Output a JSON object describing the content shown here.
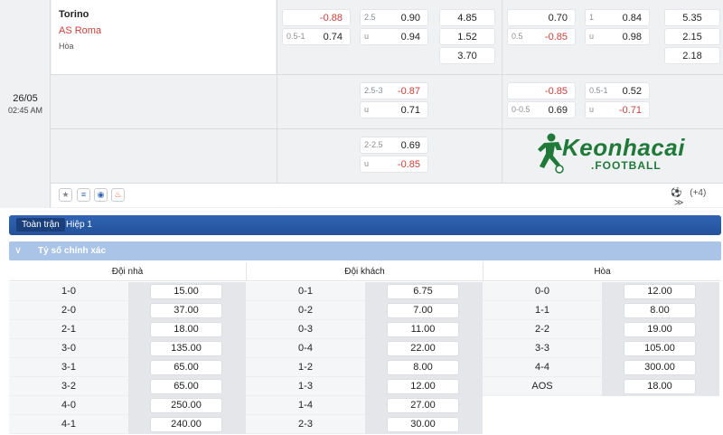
{
  "match": {
    "date": "26/05",
    "time": "02:45 AM",
    "home": "Torino",
    "away": "AS Roma",
    "draw_label": "Hòa"
  },
  "odds_rows": [
    {
      "c1": [
        {
          "lbl": "",
          "val": "-0.88",
          "neg": true
        },
        {
          "lbl": "0.5-1",
          "val": "0.74",
          "neg": false
        }
      ],
      "c2": [
        {
          "lbl": "2.5",
          "val": "0.90",
          "neg": false
        },
        {
          "lbl": "u",
          "val": "0.94",
          "neg": false
        }
      ],
      "c3": [
        "4.85",
        "1.52",
        "3.70"
      ],
      "c4": [
        {
          "lbl": "",
          "val": "0.70",
          "neg": false
        },
        {
          "lbl": "0.5",
          "val": "-0.85",
          "neg": true
        }
      ],
      "c5": [
        {
          "lbl": "1",
          "val": "0.84",
          "neg": false
        },
        {
          "lbl": "u",
          "val": "0.98",
          "neg": false
        }
      ],
      "c6": [
        "5.35",
        "2.15",
        "2.18"
      ]
    },
    {
      "c2": [
        {
          "lbl": "2.5-3",
          "val": "-0.87",
          "neg": true
        },
        {
          "lbl": "u",
          "val": "0.71",
          "neg": false
        }
      ],
      "c4": [
        {
          "lbl": "",
          "val": "-0.85",
          "neg": true
        },
        {
          "lbl": "0-0.5",
          "val": "0.69",
          "neg": false
        }
      ],
      "c5": [
        {
          "lbl": "0.5-1",
          "val": "0.52",
          "neg": false
        },
        {
          "lbl": "u",
          "val": "-0.71",
          "neg": true
        }
      ]
    },
    {
      "c2": [
        {
          "lbl": "2-2.5",
          "val": "0.69",
          "neg": false
        },
        {
          "lbl": "u",
          "val": "-0.85",
          "neg": true
        }
      ]
    }
  ],
  "logo": {
    "main": "Keonhacai",
    "sub": ".FOOTBALL"
  },
  "icons": [
    "star-icon",
    "database-icon",
    "eye-icon",
    "fire-icon"
  ],
  "more": {
    "ball": "⚽",
    "count": "(+4)",
    "chevron": "≫"
  },
  "tabs": {
    "full": "Toàn trận",
    "half": "Hiệp 1"
  },
  "section": {
    "title": "Tỷ số chính xác",
    "toggle": "∨"
  },
  "columns": [
    "Đội nhà",
    "Đội khách",
    "Hòa"
  ],
  "home_scores": [
    [
      "1-0",
      "15.00"
    ],
    [
      "2-0",
      "37.00"
    ],
    [
      "2-1",
      "18.00"
    ],
    [
      "3-0",
      "135.00"
    ],
    [
      "3-1",
      "65.00"
    ],
    [
      "3-2",
      "65.00"
    ],
    [
      "4-0",
      "250.00"
    ],
    [
      "4-1",
      "240.00"
    ]
  ],
  "away_scores": [
    [
      "0-1",
      "6.75"
    ],
    [
      "0-2",
      "7.00"
    ],
    [
      "0-3",
      "11.00"
    ],
    [
      "0-4",
      "22.00"
    ],
    [
      "1-2",
      "8.00"
    ],
    [
      "1-3",
      "12.00"
    ],
    [
      "1-4",
      "27.00"
    ],
    [
      "2-3",
      "30.00"
    ]
  ],
  "draw_scores": [
    [
      "0-0",
      "12.00"
    ],
    [
      "1-1",
      "8.00"
    ],
    [
      "2-2",
      "19.00"
    ],
    [
      "3-3",
      "105.00"
    ],
    [
      "4-4",
      "300.00"
    ],
    [
      "AOS",
      "18.00"
    ]
  ]
}
